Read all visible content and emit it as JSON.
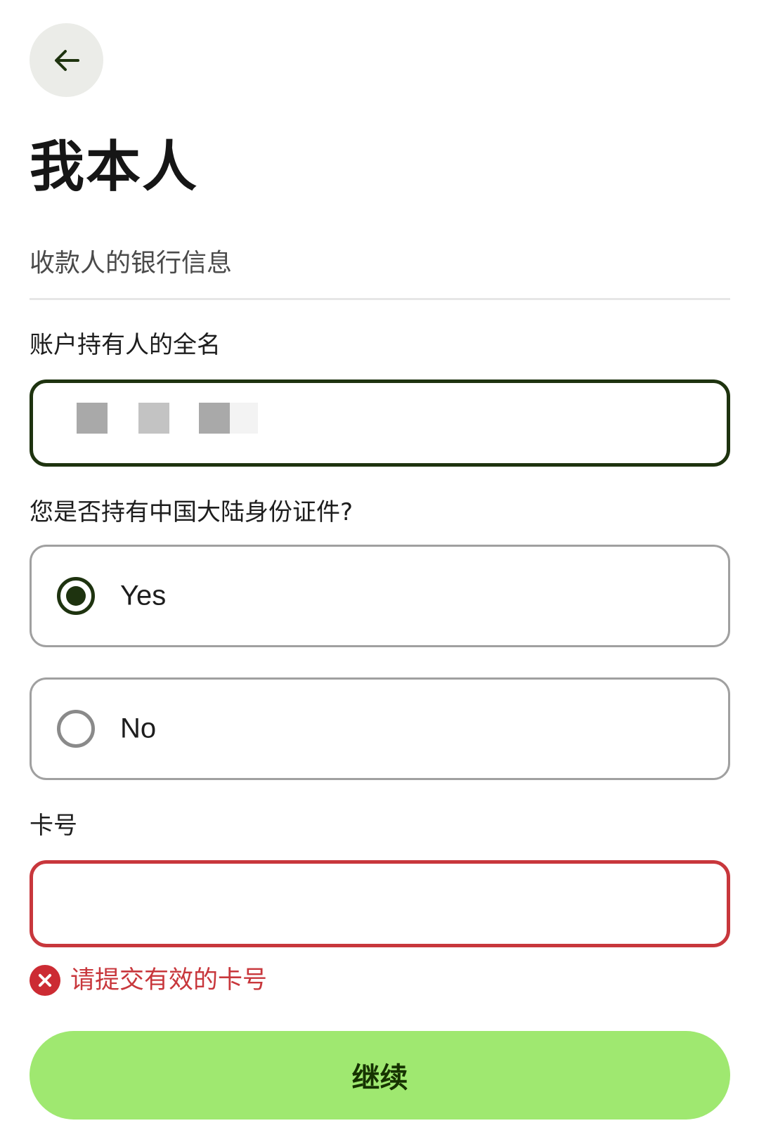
{
  "header": {
    "back_icon": "arrow-left-icon",
    "title": "我本人"
  },
  "section": {
    "subtitle": "收款人的银行信息"
  },
  "full_name": {
    "label": "账户持有人的全名",
    "value": "",
    "redacted": true
  },
  "id_question": {
    "label": "您是否持有中国大陆身份证件?",
    "options": [
      {
        "label": "Yes",
        "selected": true
      },
      {
        "label": "No",
        "selected": false
      }
    ]
  },
  "card_number": {
    "label": "卡号",
    "value": "",
    "placeholder": "",
    "error_icon": "error-x-icon",
    "error_message": "请提交有效的卡号"
  },
  "actions": {
    "continue_label": "继续"
  },
  "colors": {
    "accent_dark": "#1e330f",
    "error": "#c8373c",
    "button_bg": "#9fe870",
    "back_button_bg": "#ebece8"
  }
}
